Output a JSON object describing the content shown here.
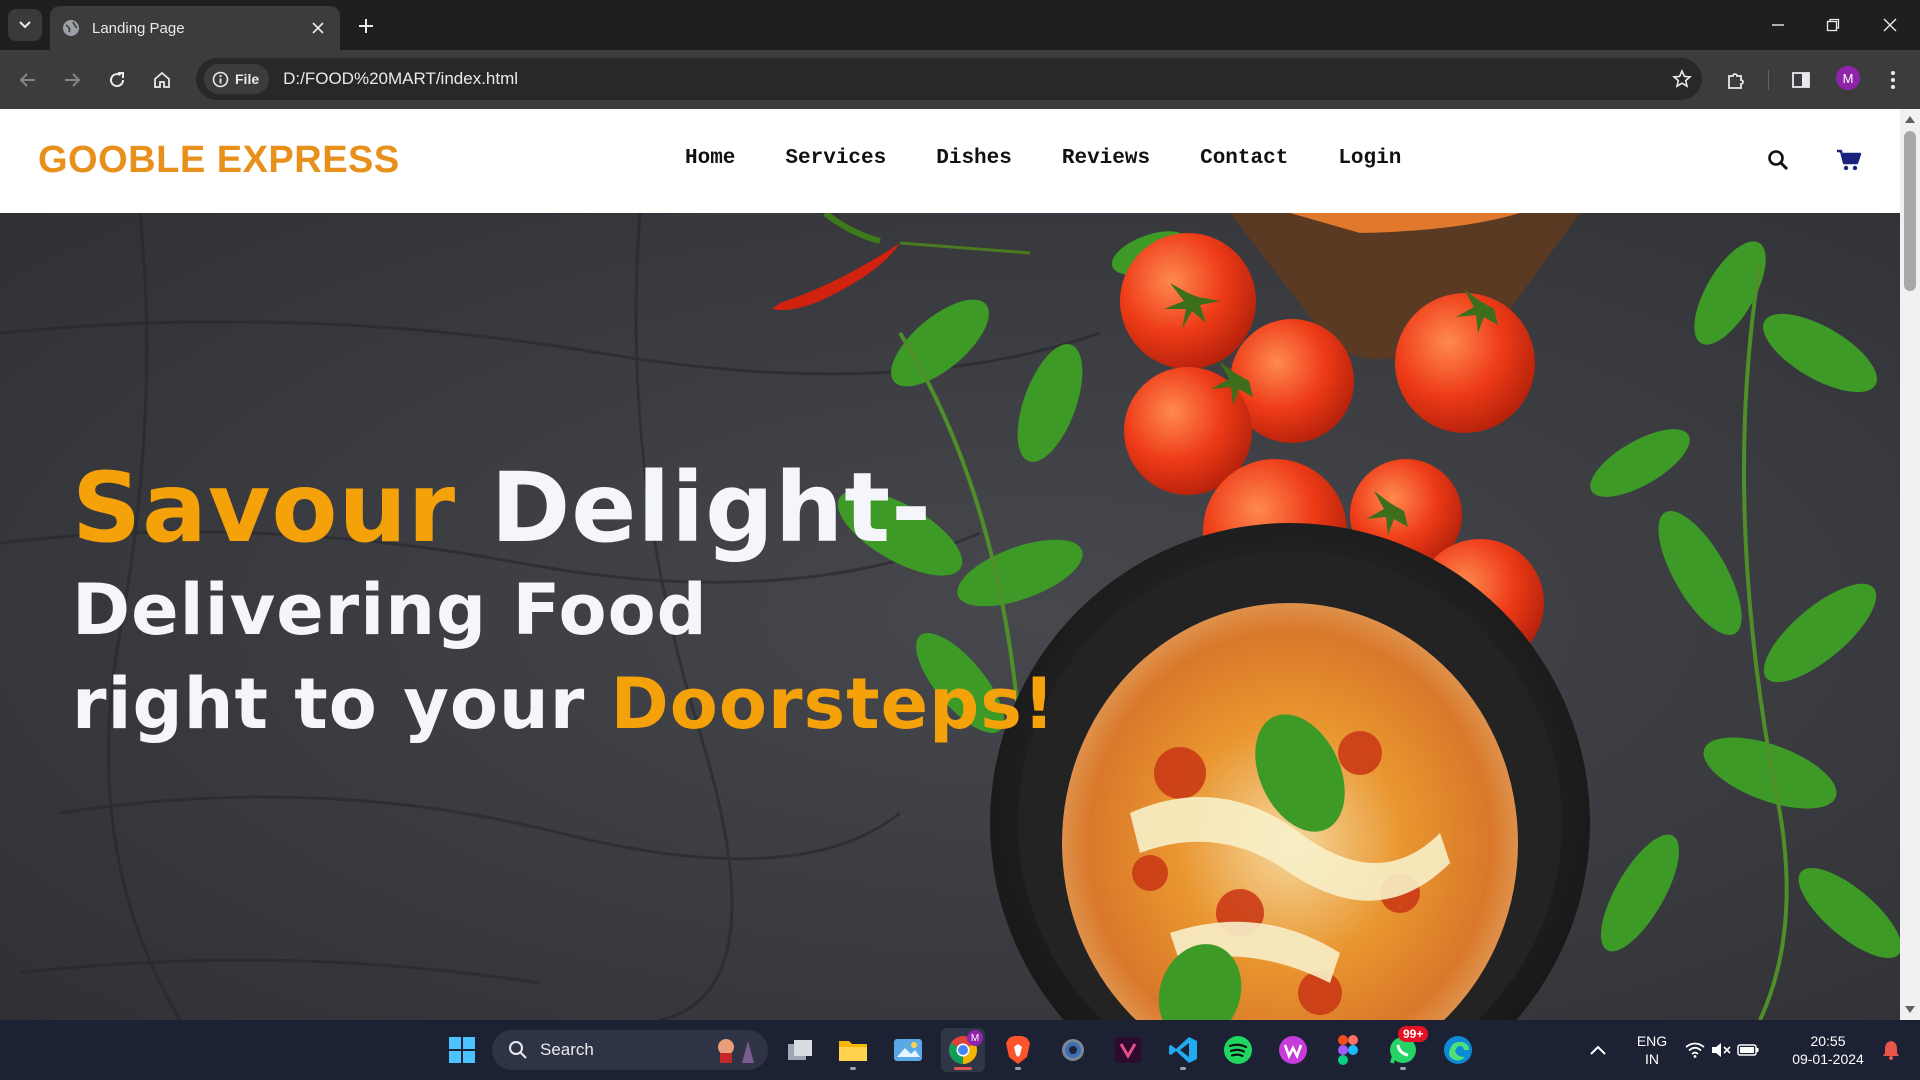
{
  "browser": {
    "tab_title": "Landing Page",
    "url": "D:/FOOD%20MART/index.html",
    "site_info_label": "File",
    "profile_initial": "M"
  },
  "page": {
    "logo": "GOOBLE EXPRESS",
    "nav": [
      "Home",
      "Services",
      "Dishes",
      "Reviews",
      "Contact",
      "Login"
    ],
    "hero": {
      "line1_accent": "Savour",
      "line1_rest": " Delight-",
      "line2": "Delivering Food",
      "line3_start": "right to your ",
      "line3_accent": "Doorsteps!"
    },
    "colors": {
      "logo": "#e8901c",
      "accent": "#f5a10a",
      "hero_text": "#f4f6fb",
      "cart": "#1a237e"
    }
  },
  "taskbar": {
    "search_label": "Search",
    "language_line1": "ENG",
    "language_line2": "IN",
    "time": "20:55",
    "date": "09-01-2024",
    "whatsapp_badge": "99+",
    "chrome_profile_badge": "M",
    "apps": [
      "start-icon",
      "search",
      "task-view-icon",
      "file-explorer-icon",
      "photos-icon",
      "chrome-icon",
      "brave-icon",
      "settings-icon",
      "vectorizer-icon",
      "vscode-icon",
      "spotify-icon",
      "wps-icon",
      "figma-icon",
      "whatsapp-icon",
      "edge-icon"
    ]
  }
}
